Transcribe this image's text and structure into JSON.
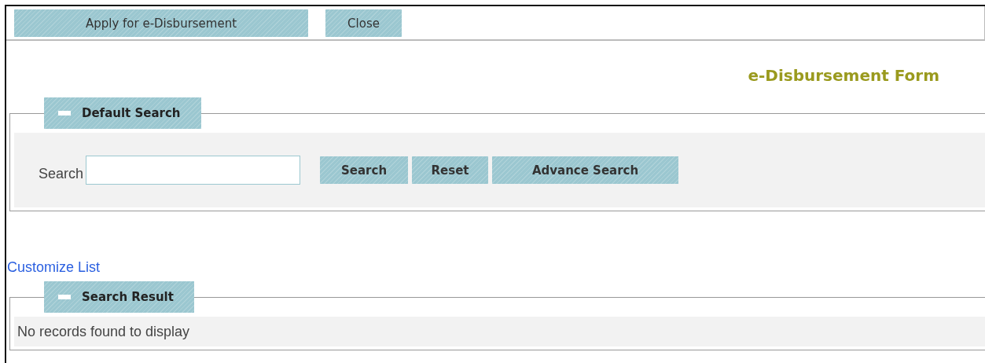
{
  "toolbar": {
    "buttons": [
      "Apply for e-Disbursement",
      "Close"
    ]
  },
  "form_title": "e-Disbursement Form",
  "default_search": {
    "legend": "Default Search",
    "expanded": true,
    "search_label": "Search",
    "buttons": [
      "Search",
      "Reset",
      "Advance Search"
    ]
  },
  "customize_link": "Customize List",
  "search_result": {
    "legend": "Search Result",
    "expanded": true,
    "message": "No records found to display"
  }
}
